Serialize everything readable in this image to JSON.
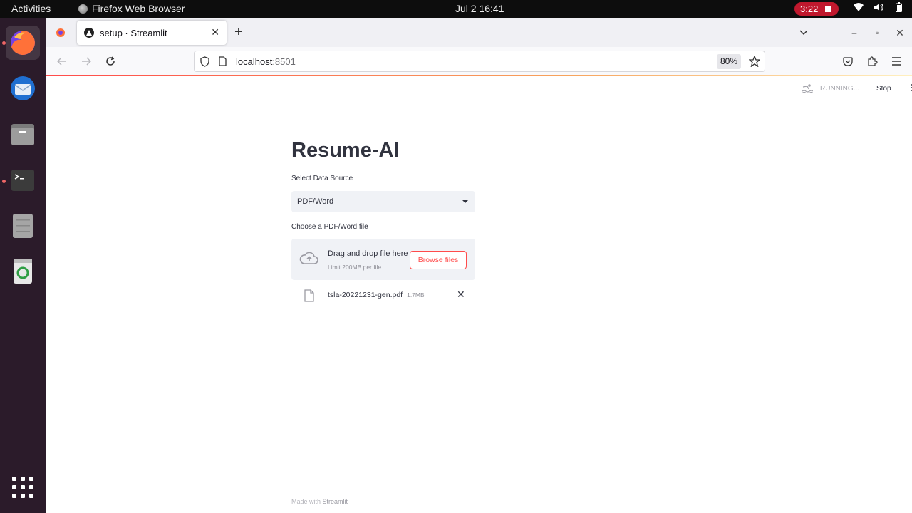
{
  "topbar": {
    "activities": "Activities",
    "app_name": "Firefox Web Browser",
    "clock": "Jul 2  16:41",
    "recording_time": "3:22"
  },
  "dock": {
    "items": [
      "firefox",
      "thunderbird",
      "files",
      "terminal",
      "drive",
      "trash",
      "show-applications"
    ]
  },
  "browser": {
    "tab_title": "setup · Streamlit",
    "url_host": "localhost",
    "url_port": ":8501",
    "zoom": "80%"
  },
  "streamlit": {
    "status": "RUNNING...",
    "stop_label": "Stop",
    "title": "Resume-AI",
    "select_label": "Select Data Source",
    "select_value": "PDF/Word",
    "uploader_label": "Choose a PDF/Word file",
    "drop_text": "Drag and drop file here",
    "limit_text": "Limit 200MB per file",
    "browse_label": "Browse files",
    "file_name": "tsla-20221231-gen.pdf",
    "file_size": "1.7MB",
    "footer_prefix": "Made with ",
    "footer_brand": "Streamlit"
  },
  "colors": {
    "accent": "#ff4b4b",
    "dock_bg": "#2b1b2a",
    "recording": "#c0182d"
  }
}
